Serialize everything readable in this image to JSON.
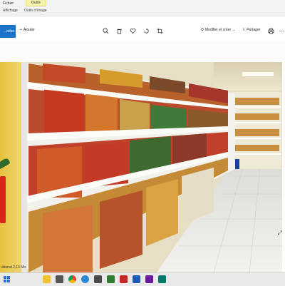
{
  "ribbon": {
    "tabs": [
      "Fichier",
      "",
      "Outils",
      ""
    ],
    "active_tab": "Outils",
    "sub_items": [
      "Affichage",
      "Outils d'image"
    ]
  },
  "toolbar": {
    "edit_label": "...odes",
    "add_label": "Ajouter",
    "slideshow_label": "Modifier et créer",
    "share_label": "Partager",
    "add_icon": "plus-icon",
    "icons": [
      "zoom-in-icon",
      "delete-icon",
      "heart-icon",
      "rotate-icon",
      "crop-icon",
      "print-icon",
      "more-icon"
    ]
  },
  "statusbar": {
    "text": "ational  2,16 Mo"
  },
  "taskbar": {
    "apps": [
      "start-icon",
      "file-explorer-icon",
      "chrome-icon",
      "edge-icon",
      "photos-icon",
      "store-icon",
      "mail-icon",
      "word-icon",
      "app-icon",
      "app-icon",
      "app-icon"
    ]
  },
  "colors": {
    "accent": "#1a73c9",
    "active_tab": "#f7f3a8",
    "shelf": "#f1efe9",
    "wall": "#e9c84a"
  }
}
